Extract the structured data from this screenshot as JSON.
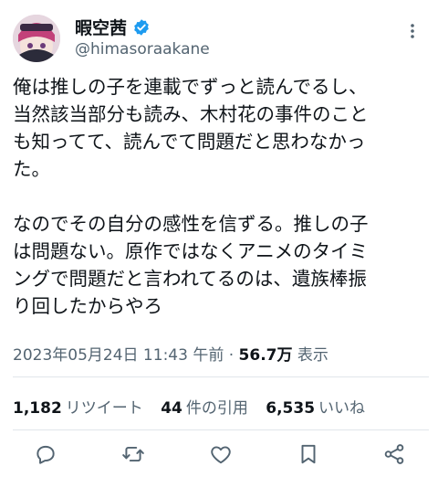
{
  "tweet": {
    "display_name": "暇空茜",
    "handle": "@himasoraakane",
    "paragraphs": [
      "俺は推しの子を連載でずっと読んでるし、\n当然該当部分も読み、木村花の事件のこと\nも知ってて、読んでて問題だと思わなかっ\nた。",
      "なのでその自分の感性を信ずる。推しの子\nは問題ない。原作ではなくアニメのタイミ\nングで問題だと言われてるのは、遺族棒振\nり回したからやろ"
    ],
    "timestamp": "2023年05月24日 11:43 午前",
    "separator": "·",
    "views": "56.7万",
    "views_label": "表示"
  },
  "stats": {
    "retweets": "1,182",
    "retweets_label": "リツイート",
    "quotes": "44",
    "quotes_label": "件の引用",
    "likes": "6,535",
    "likes_label": "いいね"
  },
  "icons": {
    "verified": "verified-badge-icon",
    "more": "more-dots-icon",
    "reply": "reply-icon",
    "retweet": "retweet-icon",
    "like": "heart-icon",
    "bookmark": "bookmark-icon",
    "share": "share-icon"
  },
  "colors": {
    "text": "#0f1419",
    "secondary": "#536471",
    "verified": "#1d9bf0",
    "divider": "#e1e6ea"
  }
}
